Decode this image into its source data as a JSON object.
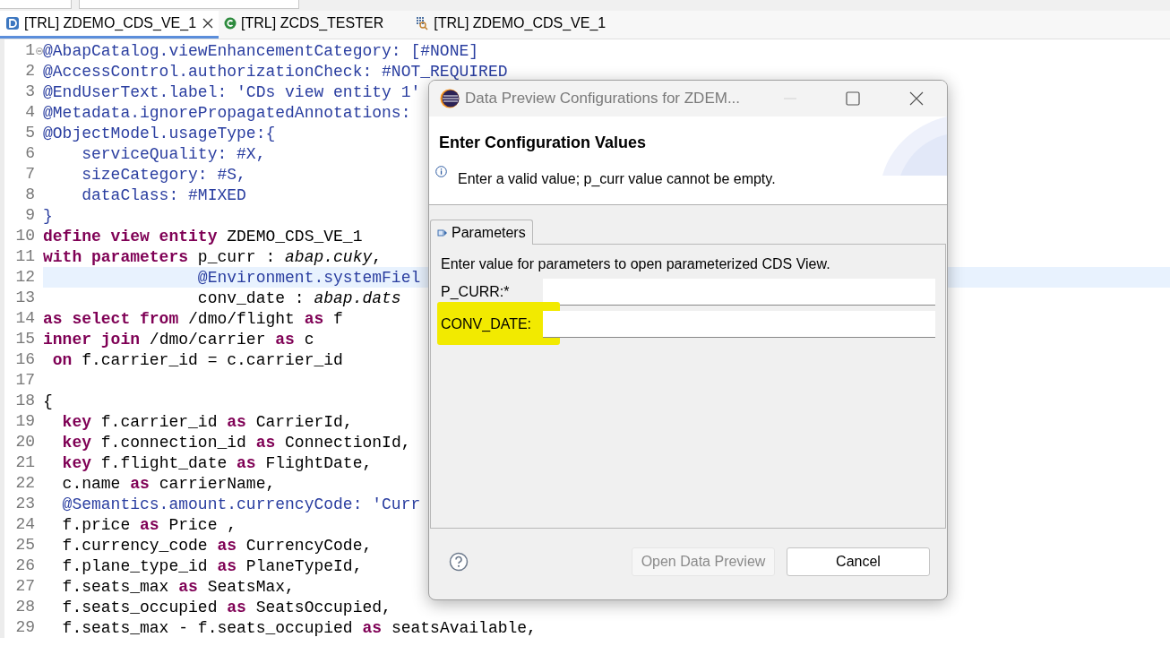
{
  "editor_tabs": [
    {
      "label": "[TRL] ZDEMO_CDS_VE_1",
      "kind": "ddl",
      "selected": true
    },
    {
      "label": "[TRL] ZCDS_TESTER",
      "kind": "class",
      "selected": false
    },
    {
      "label": "[TRL] ZDEMO_CDS_VE_1",
      "kind": "query",
      "selected": false
    }
  ],
  "editor": {
    "lines": [
      {
        "number": "1",
        "folded": true,
        "current": false,
        "tokens": [
          {
            "kind": "ann",
            "text": "@AbapCatalog.viewEnhancementCategory: [#NONE]"
          }
        ]
      },
      {
        "number": "2",
        "current": false,
        "tokens": [
          {
            "kind": "ann",
            "text": "@AccessControl.authorizationCheck: #NOT_REQUIRED"
          }
        ]
      },
      {
        "number": "3",
        "current": false,
        "tokens": [
          {
            "kind": "ann",
            "text": "@EndUserText.label: 'CDs view entity 1'"
          }
        ]
      },
      {
        "number": "4",
        "current": false,
        "tokens": [
          {
            "kind": "ann",
            "text": "@Metadata.ignorePropagatedAnnotations:"
          }
        ]
      },
      {
        "number": "5",
        "current": false,
        "tokens": [
          {
            "kind": "ann",
            "text": "@ObjectModel.usageType:{"
          }
        ]
      },
      {
        "number": "6",
        "current": false,
        "tokens": [
          {
            "kind": "ann",
            "text": "    serviceQuality: #X,"
          }
        ]
      },
      {
        "number": "7",
        "current": false,
        "tokens": [
          {
            "kind": "ann",
            "text": "    sizeCategory: #S,"
          }
        ]
      },
      {
        "number": "8",
        "current": false,
        "tokens": [
          {
            "kind": "ann",
            "text": "    dataClass: #MIXED"
          }
        ]
      },
      {
        "number": "9",
        "current": false,
        "tokens": [
          {
            "kind": "ann",
            "text": "}"
          }
        ]
      },
      {
        "number": "10",
        "current": false,
        "tokens": [
          {
            "kind": "kw",
            "text": "define view entity"
          },
          {
            "kind": "txt",
            "text": " ZDEMO_CDS_VE_1"
          }
        ]
      },
      {
        "number": "11",
        "current": false,
        "tokens": [
          {
            "kind": "kw",
            "text": "with parameters"
          },
          {
            "kind": "txt",
            "text": " p_curr : "
          },
          {
            "kind": "type",
            "text": "abap.cuky"
          },
          {
            "kind": "txt",
            "text": ","
          }
        ]
      },
      {
        "number": "12",
        "current": true,
        "tokens": [
          {
            "kind": "ann",
            "text": "                @Environment.systemFiel"
          }
        ]
      },
      {
        "number": "13",
        "current": false,
        "tokens": [
          {
            "kind": "txt",
            "text": "                conv_date : "
          },
          {
            "kind": "type",
            "text": "abap.dats"
          }
        ]
      },
      {
        "number": "14",
        "current": false,
        "tokens": [
          {
            "kind": "kw",
            "text": "as select from"
          },
          {
            "kind": "txt",
            "text": " /dmo/flight "
          },
          {
            "kind": "kw",
            "text": "as"
          },
          {
            "kind": "txt",
            "text": " f"
          }
        ]
      },
      {
        "number": "15",
        "current": false,
        "tokens": [
          {
            "kind": "kw",
            "text": "inner join"
          },
          {
            "kind": "txt",
            "text": " /dmo/carrier "
          },
          {
            "kind": "kw",
            "text": "as"
          },
          {
            "kind": "txt",
            "text": " c"
          }
        ]
      },
      {
        "number": "16",
        "current": false,
        "tokens": [
          {
            "kind": "kw",
            "text": " on"
          },
          {
            "kind": "txt",
            "text": " f.carrier_id = c.carrier_id"
          }
        ]
      },
      {
        "number": "17",
        "current": false
      },
      {
        "number": "18",
        "current": false,
        "tokens": [
          {
            "kind": "txt",
            "text": "{"
          }
        ]
      },
      {
        "number": "19",
        "current": false,
        "tokens": [
          {
            "kind": "kw",
            "text": "  key"
          },
          {
            "kind": "txt",
            "text": " f.carrier_id "
          },
          {
            "kind": "kw",
            "text": "as"
          },
          {
            "kind": "txt",
            "text": " CarrierId,"
          }
        ]
      },
      {
        "number": "20",
        "current": false,
        "tokens": [
          {
            "kind": "kw",
            "text": "  key"
          },
          {
            "kind": "txt",
            "text": " f.connection_id "
          },
          {
            "kind": "kw",
            "text": "as"
          },
          {
            "kind": "txt",
            "text": " ConnectionId,"
          }
        ]
      },
      {
        "number": "21",
        "current": false,
        "tokens": [
          {
            "kind": "kw",
            "text": "  key"
          },
          {
            "kind": "txt",
            "text": " f.flight_date "
          },
          {
            "kind": "kw",
            "text": "as"
          },
          {
            "kind": "txt",
            "text": " FlightDate,"
          }
        ]
      },
      {
        "number": "22",
        "current": false,
        "tokens": [
          {
            "kind": "txt",
            "text": "  c.name "
          },
          {
            "kind": "kw",
            "text": "as"
          },
          {
            "kind": "txt",
            "text": " carrierName,"
          }
        ]
      },
      {
        "number": "23",
        "current": false,
        "tokens": [
          {
            "kind": "ann",
            "text": "  @Semantics.amount.currencyCode: 'Curr"
          }
        ]
      },
      {
        "number": "24",
        "current": false,
        "tokens": [
          {
            "kind": "txt",
            "text": "  f.price "
          },
          {
            "kind": "kw",
            "text": "as"
          },
          {
            "kind": "txt",
            "text": " Price ,"
          }
        ]
      },
      {
        "number": "25",
        "current": false,
        "tokens": [
          {
            "kind": "txt",
            "text": "  f.currency_code "
          },
          {
            "kind": "kw",
            "text": "as"
          },
          {
            "kind": "txt",
            "text": " CurrencyCode,"
          }
        ]
      },
      {
        "number": "26",
        "current": false,
        "tokens": [
          {
            "kind": "txt",
            "text": "  f.plane_type_id "
          },
          {
            "kind": "kw",
            "text": "as"
          },
          {
            "kind": "txt",
            "text": " PlaneTypeId,"
          }
        ]
      },
      {
        "number": "27",
        "current": false,
        "tokens": [
          {
            "kind": "txt",
            "text": "  f.seats_max "
          },
          {
            "kind": "kw",
            "text": "as"
          },
          {
            "kind": "txt",
            "text": " SeatsMax,"
          }
        ]
      },
      {
        "number": "28",
        "current": false,
        "tokens": [
          {
            "kind": "txt",
            "text": "  f.seats_occupied "
          },
          {
            "kind": "kw",
            "text": "as"
          },
          {
            "kind": "txt",
            "text": " SeatsOccupied,"
          }
        ]
      },
      {
        "number": "29",
        "current": false,
        "tokens": [
          {
            "kind": "txt",
            "text": "  f.seats_max - f.seats_occupied "
          },
          {
            "kind": "kw",
            "text": "as"
          },
          {
            "kind": "txt",
            "text": " seatsAvailable,"
          }
        ]
      }
    ]
  },
  "dialog": {
    "title": "Data Preview Configurations for ZDEM...",
    "heading": "Enter Configuration Values",
    "message": "Enter a valid value; p_curr value cannot be empty.",
    "tabs": [
      {
        "label": "Parameters",
        "selected": true
      }
    ],
    "instruction": "Enter value for parameters to open parameterized CDS View.",
    "fields": [
      {
        "label": "P_CURR:*",
        "highlighted": false
      },
      {
        "label": "CONV_DATE:",
        "highlighted": true
      }
    ],
    "buttons": [
      {
        "label": "Open Data Preview",
        "disabled": true
      },
      {
        "label": "Cancel",
        "disabled": false
      }
    ]
  }
}
